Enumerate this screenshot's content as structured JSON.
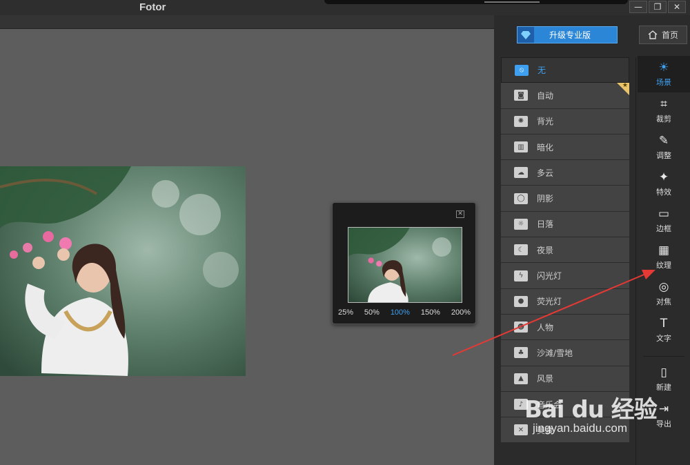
{
  "app": {
    "title": "Fotor"
  },
  "window_controls": {
    "minimize": "—",
    "restore": "❐",
    "close": "✕"
  },
  "navigator": {
    "close": "✕",
    "zoom_levels": [
      "25%",
      "50%",
      "100%",
      "150%",
      "200%"
    ],
    "active_zoom": "100%"
  },
  "header": {
    "upgrade_label": "升级专业版",
    "home_label": "首页"
  },
  "scenes": [
    {
      "label": "无",
      "icon": "⦸",
      "selected": true
    },
    {
      "label": "自动",
      "icon": "◙",
      "pro": true
    },
    {
      "label": "背光",
      "icon": "✺"
    },
    {
      "label": "暗化",
      "icon": "▥"
    },
    {
      "label": "多云",
      "icon": "☁"
    },
    {
      "label": "阴影",
      "icon": "◯"
    },
    {
      "label": "日落",
      "icon": "☼"
    },
    {
      "label": "夜景",
      "icon": "☾"
    },
    {
      "label": "闪光灯",
      "icon": "ϟ"
    },
    {
      "label": "荧光灯",
      "icon": "●"
    },
    {
      "label": "人物",
      "icon": "☻"
    },
    {
      "label": "沙滩/雪地",
      "icon": "♣"
    },
    {
      "label": "风景",
      "icon": "▲"
    },
    {
      "label": "音乐会",
      "icon": "♪"
    },
    {
      "label": "美食",
      "icon": "✕"
    }
  ],
  "tools": [
    {
      "label": "场景",
      "icon": "☀",
      "active": true
    },
    {
      "label": "裁剪",
      "icon": "⌗"
    },
    {
      "label": "调整",
      "icon": "✎"
    },
    {
      "label": "特效",
      "icon": "✦"
    },
    {
      "label": "边框",
      "icon": "▭"
    },
    {
      "label": "纹理",
      "icon": "▦"
    },
    {
      "label": "对焦",
      "icon": "◎"
    },
    {
      "label": "文字",
      "icon": "T"
    }
  ],
  "file_tools": [
    {
      "label": "新建",
      "icon": "▯"
    },
    {
      "label": "导出",
      "icon": "⇥"
    }
  ],
  "watermark": {
    "logo": "Bai du 经验",
    "url": "jingyan.baidu.com"
  },
  "colors": {
    "accent": "#3fa0f0",
    "annotation": "#e53935",
    "pro_badge": "#e9c46a"
  }
}
